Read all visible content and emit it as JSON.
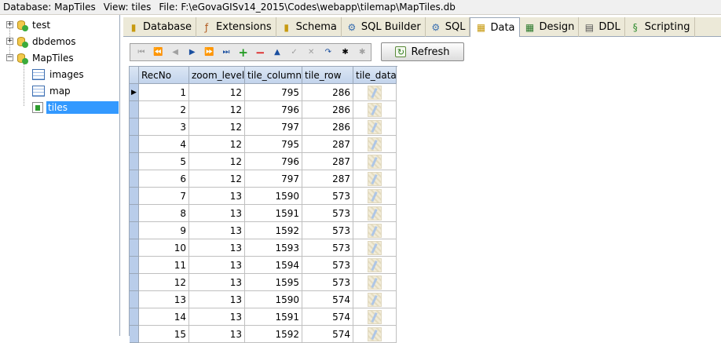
{
  "infobar": {
    "database": "Database: MapTiles",
    "view": "View: tiles",
    "file": "File: F:\\eGovaGISv14_2015\\Codes\\webapp\\tilemap\\MapTiles.db"
  },
  "tree": {
    "databases": [
      {
        "label": "test",
        "expander": "+"
      },
      {
        "label": "dbdemos",
        "expander": "+"
      },
      {
        "label": "MapTiles",
        "expander": "−"
      }
    ],
    "children": [
      {
        "label": "images",
        "kind": "table-icon"
      },
      {
        "label": "map",
        "kind": "table-icon"
      },
      {
        "label": "tiles",
        "kind": "view-icon",
        "selected": true
      }
    ]
  },
  "tabs": [
    {
      "label": "Database",
      "icon": "database-icon"
    },
    {
      "label": "Extensions",
      "icon": "extensions-icon"
    },
    {
      "label": "Schema",
      "icon": "schema-icon"
    },
    {
      "label": "SQL Builder",
      "icon": "sql-builder-icon"
    },
    {
      "label": "SQL",
      "icon": "sql-icon"
    },
    {
      "label": "Data",
      "icon": "data-icon",
      "active": true
    },
    {
      "label": "Design",
      "icon": "design-icon"
    },
    {
      "label": "DDL",
      "icon": "ddl-icon"
    },
    {
      "label": "Scripting",
      "icon": "scripting-icon"
    }
  ],
  "toolbar": {
    "refresh_label": "Refresh"
  },
  "grid": {
    "columns": [
      "RecNo",
      "zoom_level",
      "tile_column",
      "tile_row",
      "tile_data"
    ],
    "rows": [
      {
        "recno": "1",
        "zoom": "12",
        "col": "795",
        "row": "286"
      },
      {
        "recno": "2",
        "zoom": "12",
        "col": "796",
        "row": "286"
      },
      {
        "recno": "3",
        "zoom": "12",
        "col": "797",
        "row": "286"
      },
      {
        "recno": "4",
        "zoom": "12",
        "col": "795",
        "row": "287"
      },
      {
        "recno": "5",
        "zoom": "12",
        "col": "796",
        "row": "287"
      },
      {
        "recno": "6",
        "zoom": "12",
        "col": "797",
        "row": "287"
      },
      {
        "recno": "7",
        "zoom": "13",
        "col": "1590",
        "row": "573"
      },
      {
        "recno": "8",
        "zoom": "13",
        "col": "1591",
        "row": "573"
      },
      {
        "recno": "9",
        "zoom": "13",
        "col": "1592",
        "row": "573"
      },
      {
        "recno": "10",
        "zoom": "13",
        "col": "1593",
        "row": "573"
      },
      {
        "recno": "11",
        "zoom": "13",
        "col": "1594",
        "row": "573"
      },
      {
        "recno": "12",
        "zoom": "13",
        "col": "1595",
        "row": "573"
      },
      {
        "recno": "13",
        "zoom": "13",
        "col": "1590",
        "row": "574"
      },
      {
        "recno": "14",
        "zoom": "13",
        "col": "1591",
        "row": "574"
      },
      {
        "recno": "15",
        "zoom": "13",
        "col": "1592",
        "row": "574"
      }
    ]
  }
}
